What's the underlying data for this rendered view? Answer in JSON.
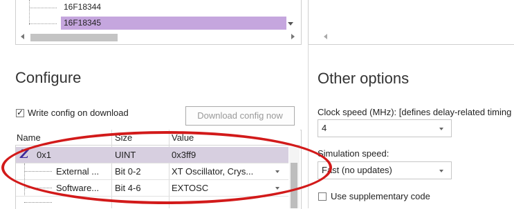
{
  "device_tree": {
    "items": [
      "16F18344",
      "16F18345"
    ],
    "selected_index": 1
  },
  "configure": {
    "title": "Configure",
    "write_config_label": "Write config on download",
    "write_config_checked": true,
    "download_button_label": "Download config now",
    "download_button_enabled": false,
    "grid": {
      "columns": [
        "Name",
        "Size",
        "Value"
      ],
      "rows": [
        {
          "icon": "Z",
          "name": "0x1",
          "size": "UINT",
          "value": "0x3ff9",
          "has_dropdown": false
        },
        {
          "name": "External ...",
          "size": "Bit 0-2",
          "value": "XT Oscillator, Crys...",
          "has_dropdown": true
        },
        {
          "name": "Software...",
          "size": "Bit 4-6",
          "value": "EXTOSC",
          "has_dropdown": true
        },
        {
          "name": "",
          "size": "",
          "value": "",
          "has_dropdown": false
        }
      ]
    }
  },
  "other_options": {
    "title": "Other options",
    "clock_speed_label": "Clock speed (MHz): [defines delay-related timing",
    "clock_speed_value": "4",
    "simulation_speed_label": "Simulation speed:",
    "simulation_speed_value": "Fast (no updates)",
    "supplementary_label": "Use supplementary code",
    "supplementary_checked": false
  },
  "colors": {
    "selection_purple": "#c5a6de",
    "row_selected": "#d7cfe0",
    "annotation_red": "#d21a1a"
  }
}
